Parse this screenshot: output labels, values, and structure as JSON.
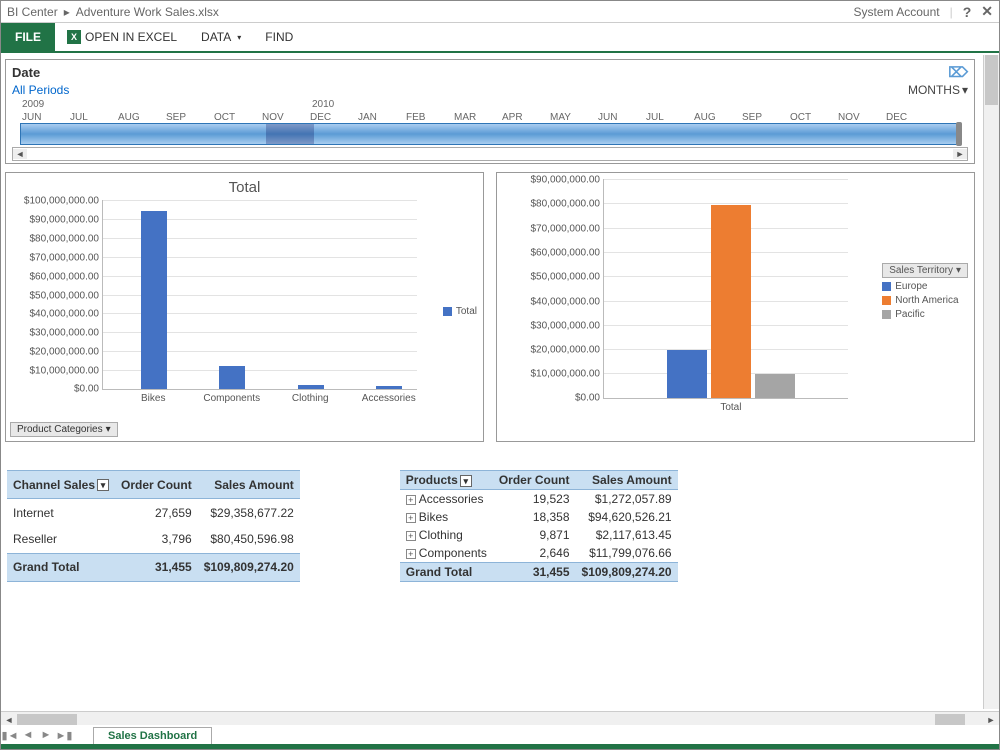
{
  "breadcrumb": {
    "root": "BI Center",
    "sep": "▸",
    "file": "Adventure Work Sales.xlsx",
    "account": "System Account"
  },
  "ribbon": {
    "file": "FILE",
    "open_excel": "OPEN IN EXCEL",
    "data": "DATA",
    "find": "FIND"
  },
  "timeline": {
    "title": "Date",
    "all_periods": "All Periods",
    "level_label": "MONTHS",
    "years": [
      "2009",
      "2010"
    ],
    "months": [
      "JUN",
      "JUL",
      "AUG",
      "SEP",
      "OCT",
      "NOV",
      "DEC",
      "JAN",
      "FEB",
      "MAR",
      "APR",
      "MAY",
      "JUN",
      "JUL",
      "AUG",
      "SEP",
      "OCT",
      "NOV",
      "DEC"
    ]
  },
  "chart1": {
    "title": "Total",
    "filter_label": "Product Categories",
    "legend": "Total",
    "yticks": [
      "$100,000,000.00",
      "$90,000,000.00",
      "$80,000,000.00",
      "$70,000,000.00",
      "$60,000,000.00",
      "$50,000,000.00",
      "$40,000,000.00",
      "$30,000,000.00",
      "$20,000,000.00",
      "$10,000,000.00",
      "$0.00"
    ],
    "cats": [
      "Bikes",
      "Components",
      "Clothing",
      "Accessories"
    ]
  },
  "chart2": {
    "legend_title": "Sales Territory",
    "legend": [
      "Europe",
      "North America",
      "Pacific"
    ],
    "yticks": [
      "$90,000,000.00",
      "$80,000,000.00",
      "$70,000,000.00",
      "$60,000,000.00",
      "$50,000,000.00",
      "$40,000,000.00",
      "$30,000,000.00",
      "$20,000,000.00",
      "$10,000,000.00",
      "$0.00"
    ],
    "xcat": "Total"
  },
  "table1": {
    "headers": [
      "Channel Sales",
      "Order Count",
      "Sales Amount"
    ],
    "rows": [
      [
        "Internet",
        "27,659",
        "$29,358,677.22"
      ],
      [
        "Reseller",
        "3,796",
        "$80,450,596.98"
      ]
    ],
    "grand": [
      "Grand Total",
      "31,455",
      "$109,809,274.20"
    ]
  },
  "table2": {
    "headers": [
      "Products",
      "Order Count",
      "Sales Amount"
    ],
    "rows": [
      [
        "Accessories",
        "19,523",
        "$1,272,057.89"
      ],
      [
        "Bikes",
        "18,358",
        "$94,620,526.21"
      ],
      [
        "Clothing",
        "9,871",
        "$2,117,613.45"
      ],
      [
        "Components",
        "2,646",
        "$11,799,076.66"
      ]
    ],
    "grand": [
      "Grand Total",
      "31,455",
      "$109,809,274.20"
    ]
  },
  "sheet": {
    "name": "Sales Dashboard"
  },
  "chart_data": [
    {
      "type": "bar",
      "title": "Total",
      "categories": [
        "Bikes",
        "Components",
        "Clothing",
        "Accessories"
      ],
      "series": [
        {
          "name": "Total",
          "values": [
            94000000,
            12000000,
            2000000,
            1500000
          ]
        }
      ],
      "ylabel": "",
      "ylim": [
        0,
        100000000
      ],
      "filter": "Product Categories"
    },
    {
      "type": "bar",
      "title": "",
      "categories": [
        "Total"
      ],
      "series": [
        {
          "name": "Europe",
          "values": [
            20000000
          ]
        },
        {
          "name": "North America",
          "values": [
            79000000
          ]
        },
        {
          "name": "Pacific",
          "values": [
            10000000
          ]
        }
      ],
      "ylabel": "",
      "ylim": [
        0,
        90000000
      ],
      "legend_title": "Sales Territory"
    }
  ]
}
